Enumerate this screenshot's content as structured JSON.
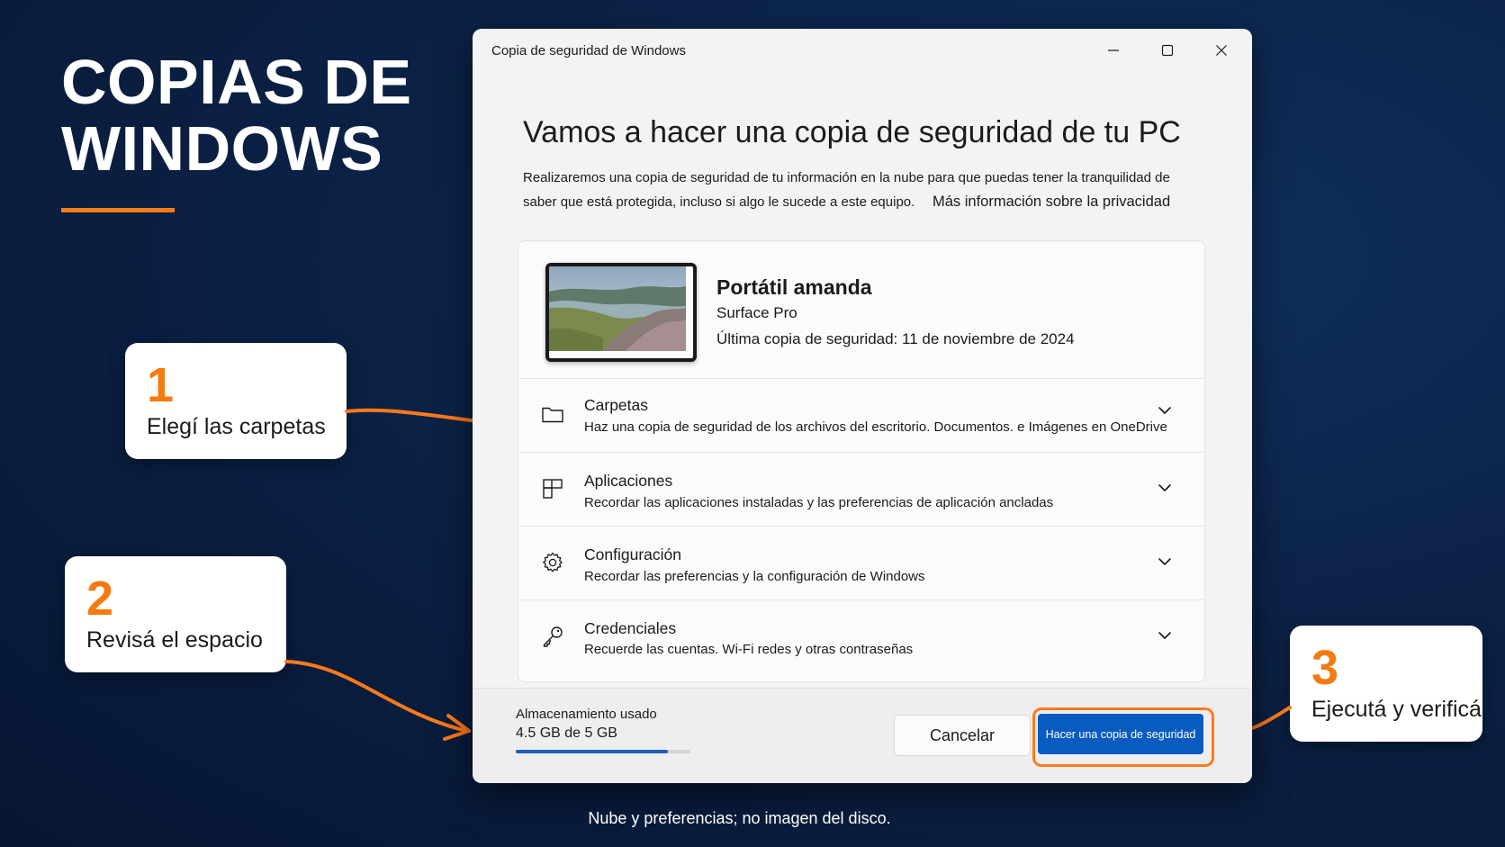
{
  "slide": {
    "headline": [
      "COPIAS DE",
      "WINDOWS"
    ],
    "callouts": [
      {
        "number": "1",
        "text": "Elegí las carpetas"
      },
      {
        "number": "2",
        "text": "Revisá el espacio"
      },
      {
        "number": "3",
        "text": "Ejecutá y verificá"
      }
    ],
    "caption": "Nube y preferencias; no imagen del disco.",
    "accent_color": "#ff7a1a"
  },
  "window": {
    "title": "Copia de seguridad de Windows",
    "controls": [
      "minimize-icon",
      "maximize-icon",
      "close-icon"
    ],
    "heading": "Vamos a hacer una copia de seguridad de tu PC",
    "description_line1": "Realizaremos una copia de seguridad de tu información en la nube para que puedas tener la tranquilidad de",
    "description_line2": "saber que está protegida, incluso si algo le sucede a este equipo.",
    "privacy_link": "Más información sobre la privacidad",
    "device": {
      "name": "Portátil amanda",
      "model": "Surface Pro",
      "last_backup": "Última copia de seguridad: 11 de noviembre de 2024"
    },
    "sections": [
      {
        "icon": "folder-icon",
        "title": "Carpetas",
        "subtitle": "Haz una copia de seguridad de los archivos del escritorio. Documentos. e Imágenes en OneDrive"
      },
      {
        "icon": "apps-icon",
        "title": "Aplicaciones",
        "subtitle": "Recordar las aplicaciones instaladas y las preferencias de aplicación ancladas"
      },
      {
        "icon": "gear-icon",
        "title": "Configuración",
        "subtitle": "Recordar las preferencias y la configuración de Windows"
      },
      {
        "icon": "key-icon",
        "title": "Credenciales",
        "subtitle": "Recuerde las cuentas. Wi-Fi redes y otras contraseñas"
      }
    ],
    "footer": {
      "storage_label": "Almacenamiento usado",
      "storage_value": "4.5 GB de 5 GB",
      "storage_used_fraction": 0.87,
      "cancel_label": "Cancelar",
      "primary_label": "Hacer una copia de seguridad",
      "primary_color": "#0a5bbf"
    }
  }
}
